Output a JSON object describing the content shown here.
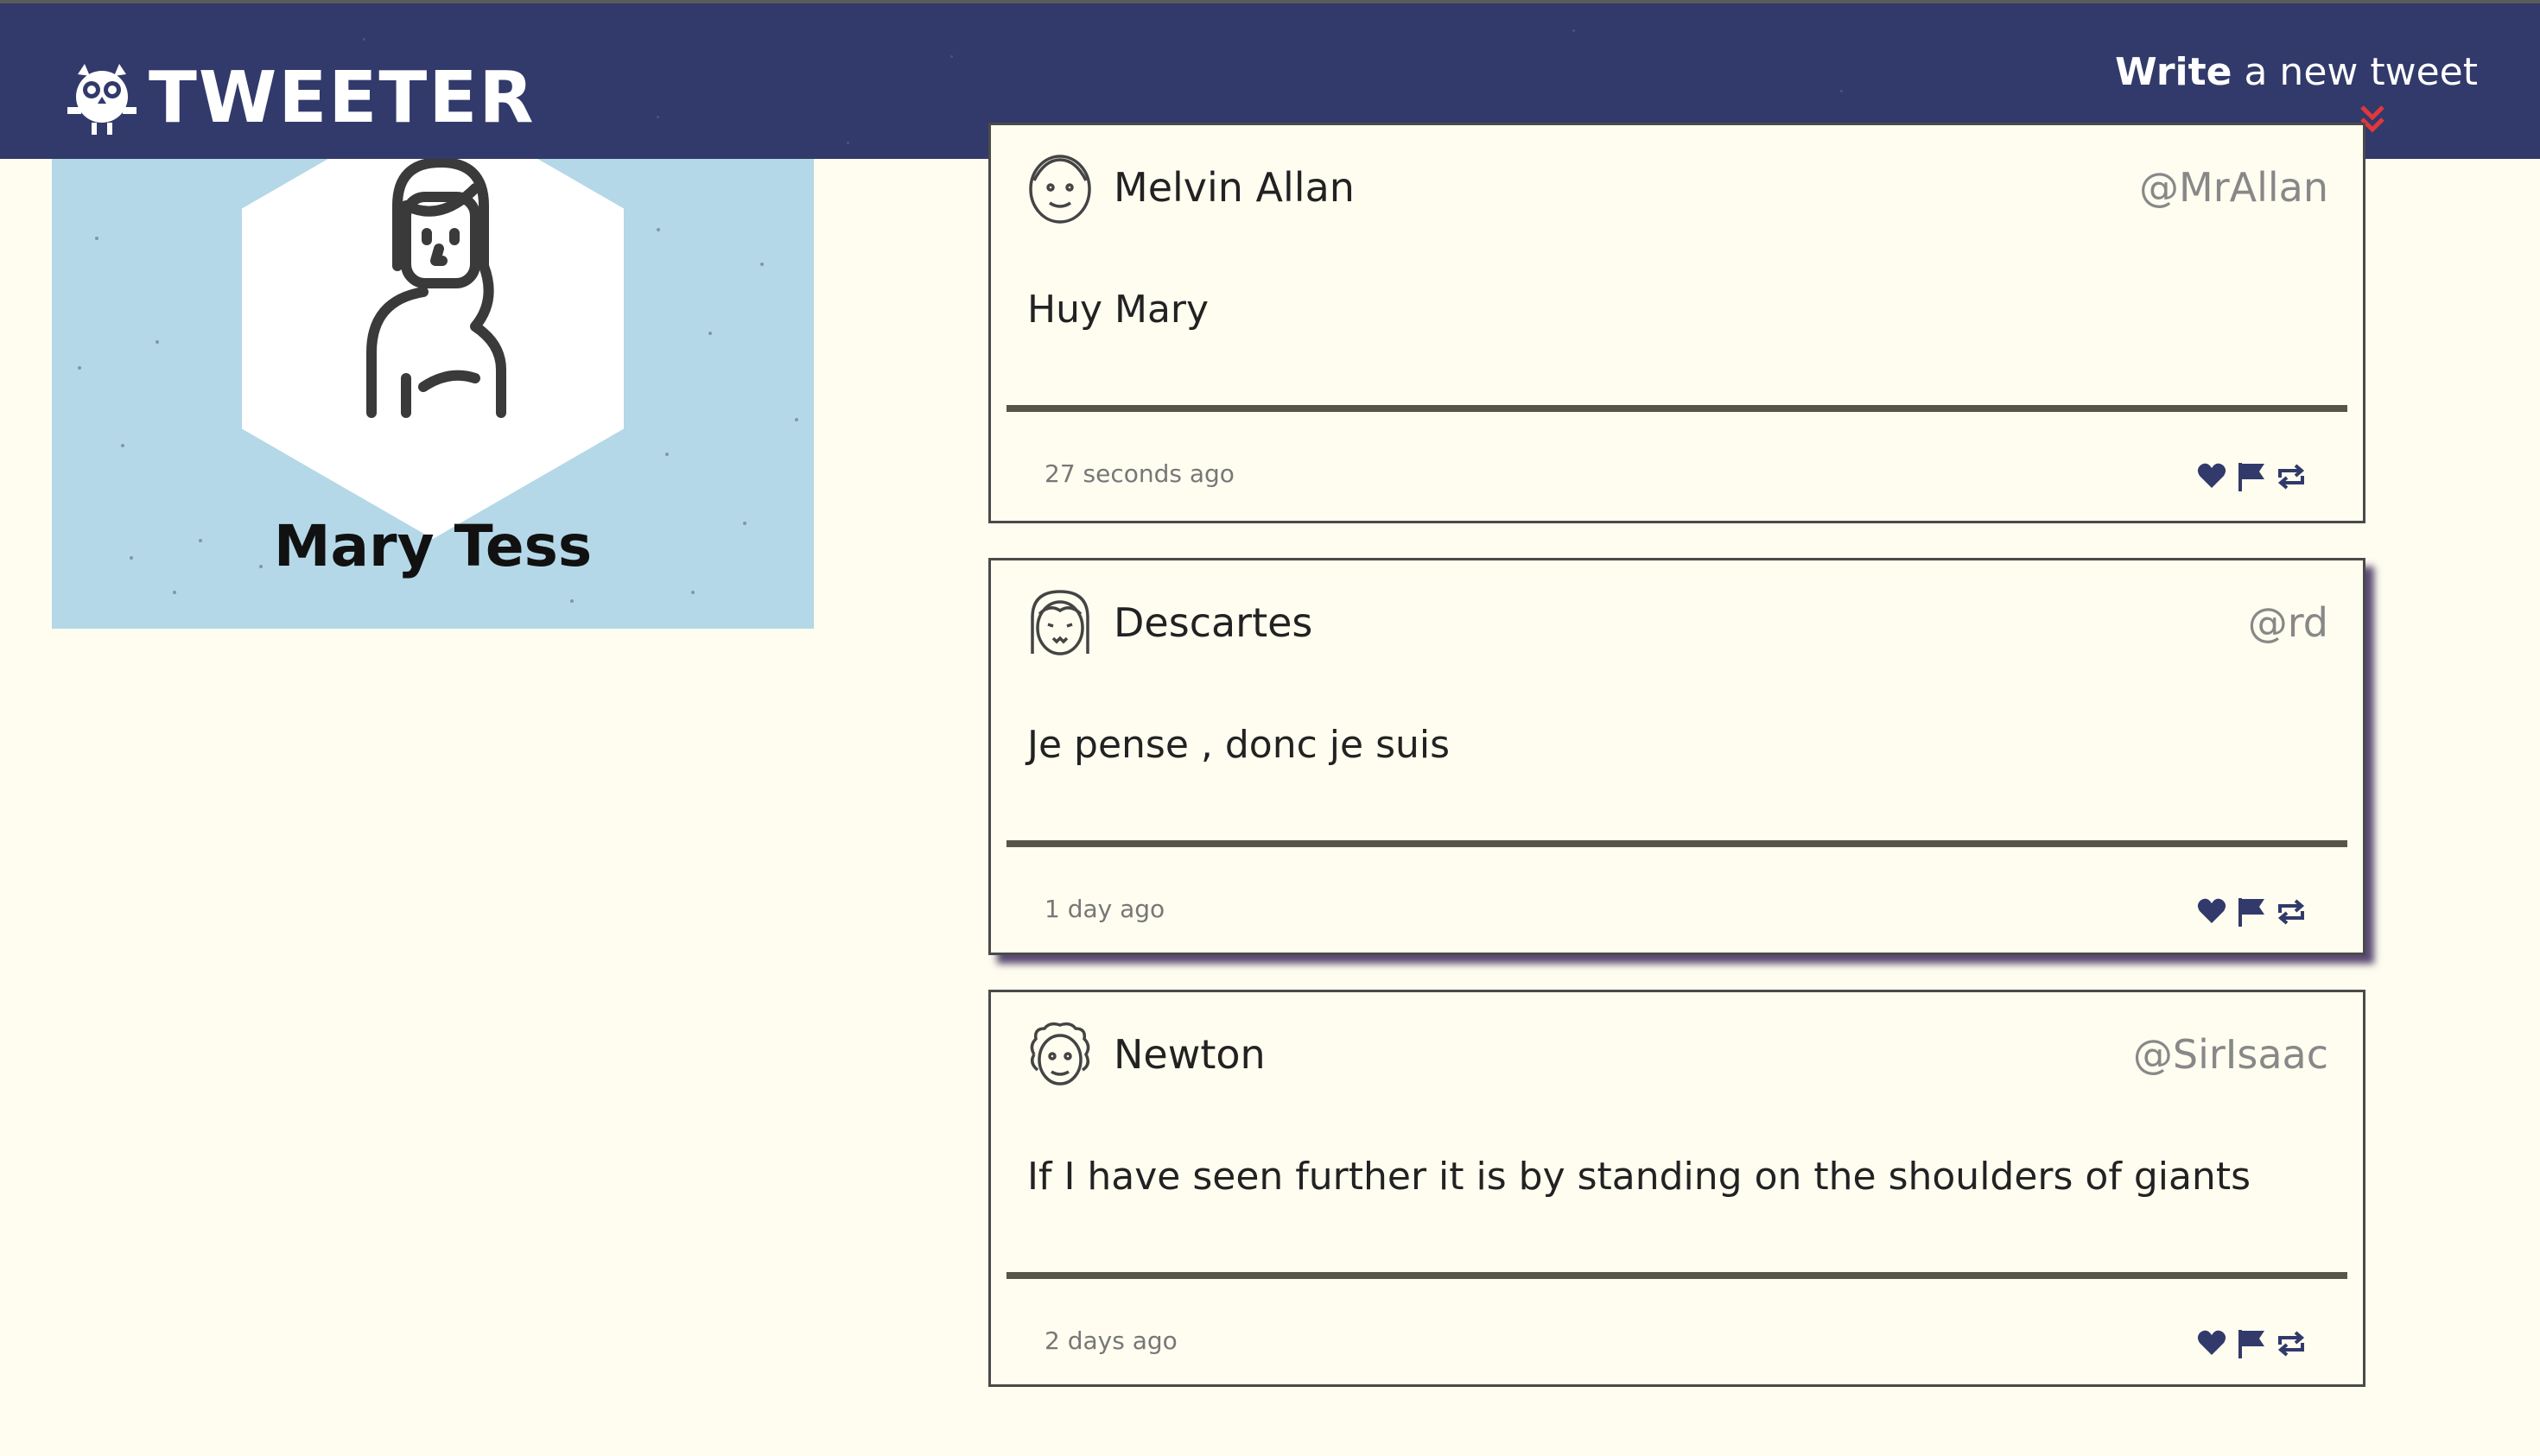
{
  "header": {
    "brand": "TWEETER",
    "compose_bold": "Write",
    "compose_rest": " a new tweet"
  },
  "profile": {
    "name": "Mary Tess"
  },
  "tweets": [
    {
      "name": "Melvin Allan",
      "handle": "@MrAllan",
      "text": "Huy Mary",
      "time": "27 seconds ago"
    },
    {
      "name": "Descartes",
      "handle": "@rd",
      "text": "Je pense , donc je suis",
      "time": "1 day ago"
    },
    {
      "name": "Newton",
      "handle": "@SirIsaac",
      "text": "If I have seen further it is by standing on the shoulders of giants",
      "time": "2 days ago"
    }
  ],
  "icons": {
    "like": "heart-icon",
    "flag": "flag-icon",
    "retweet": "retweet-icon",
    "compose_toggle": "double-chevron-down-icon"
  },
  "colors": {
    "navbar": "#313a6a",
    "background": "#fefdf0",
    "profile_bg": "#b4d8e7",
    "accent_red": "#e0383e",
    "icon_navy": "#313a6a"
  }
}
